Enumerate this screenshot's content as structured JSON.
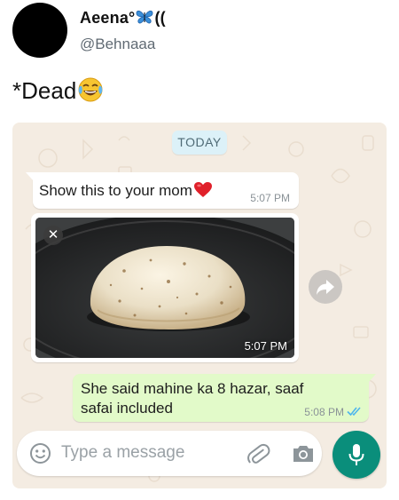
{
  "tweet": {
    "display_name": "Aeena°",
    "display_name_suffix": "((",
    "handle": "@Behnaaa",
    "text": "*Dead"
  },
  "chat": {
    "date_chip": "TODAY",
    "messages": [
      {
        "direction": "incoming",
        "text": "Show this to your mom",
        "time": "5:07 PM"
      },
      {
        "direction": "incoming",
        "type": "image",
        "time": "5:07 PM"
      },
      {
        "direction": "outgoing",
        "text": "She said mahine ka 8 hazar, saaf safai included",
        "time": "5:08 PM",
        "status": "read"
      }
    ]
  },
  "input_bar": {
    "placeholder": "Type a message"
  },
  "icons": {
    "avatar": "avatar",
    "name_emoji": "butterfly-icon",
    "tweet_emoji": "laughing-crying-emoji-icon",
    "heart": "red-heart-icon",
    "close": "close-icon",
    "forward": "forward-icon",
    "ticks": "double-check-icon",
    "emoji": "emoji-icon",
    "attach": "paperclip-icon",
    "camera": "camera-icon",
    "mic": "mic-icon"
  },
  "colors": {
    "chat_background": "#f4ece2",
    "outgoing_bubble": "#e2fac9",
    "incoming_bubble": "#ffffff",
    "date_chip": "#dcf1f8",
    "read_ticks": "#4fb6ec",
    "mic_button": "#0a8e7b",
    "heart": "#e0202a"
  }
}
